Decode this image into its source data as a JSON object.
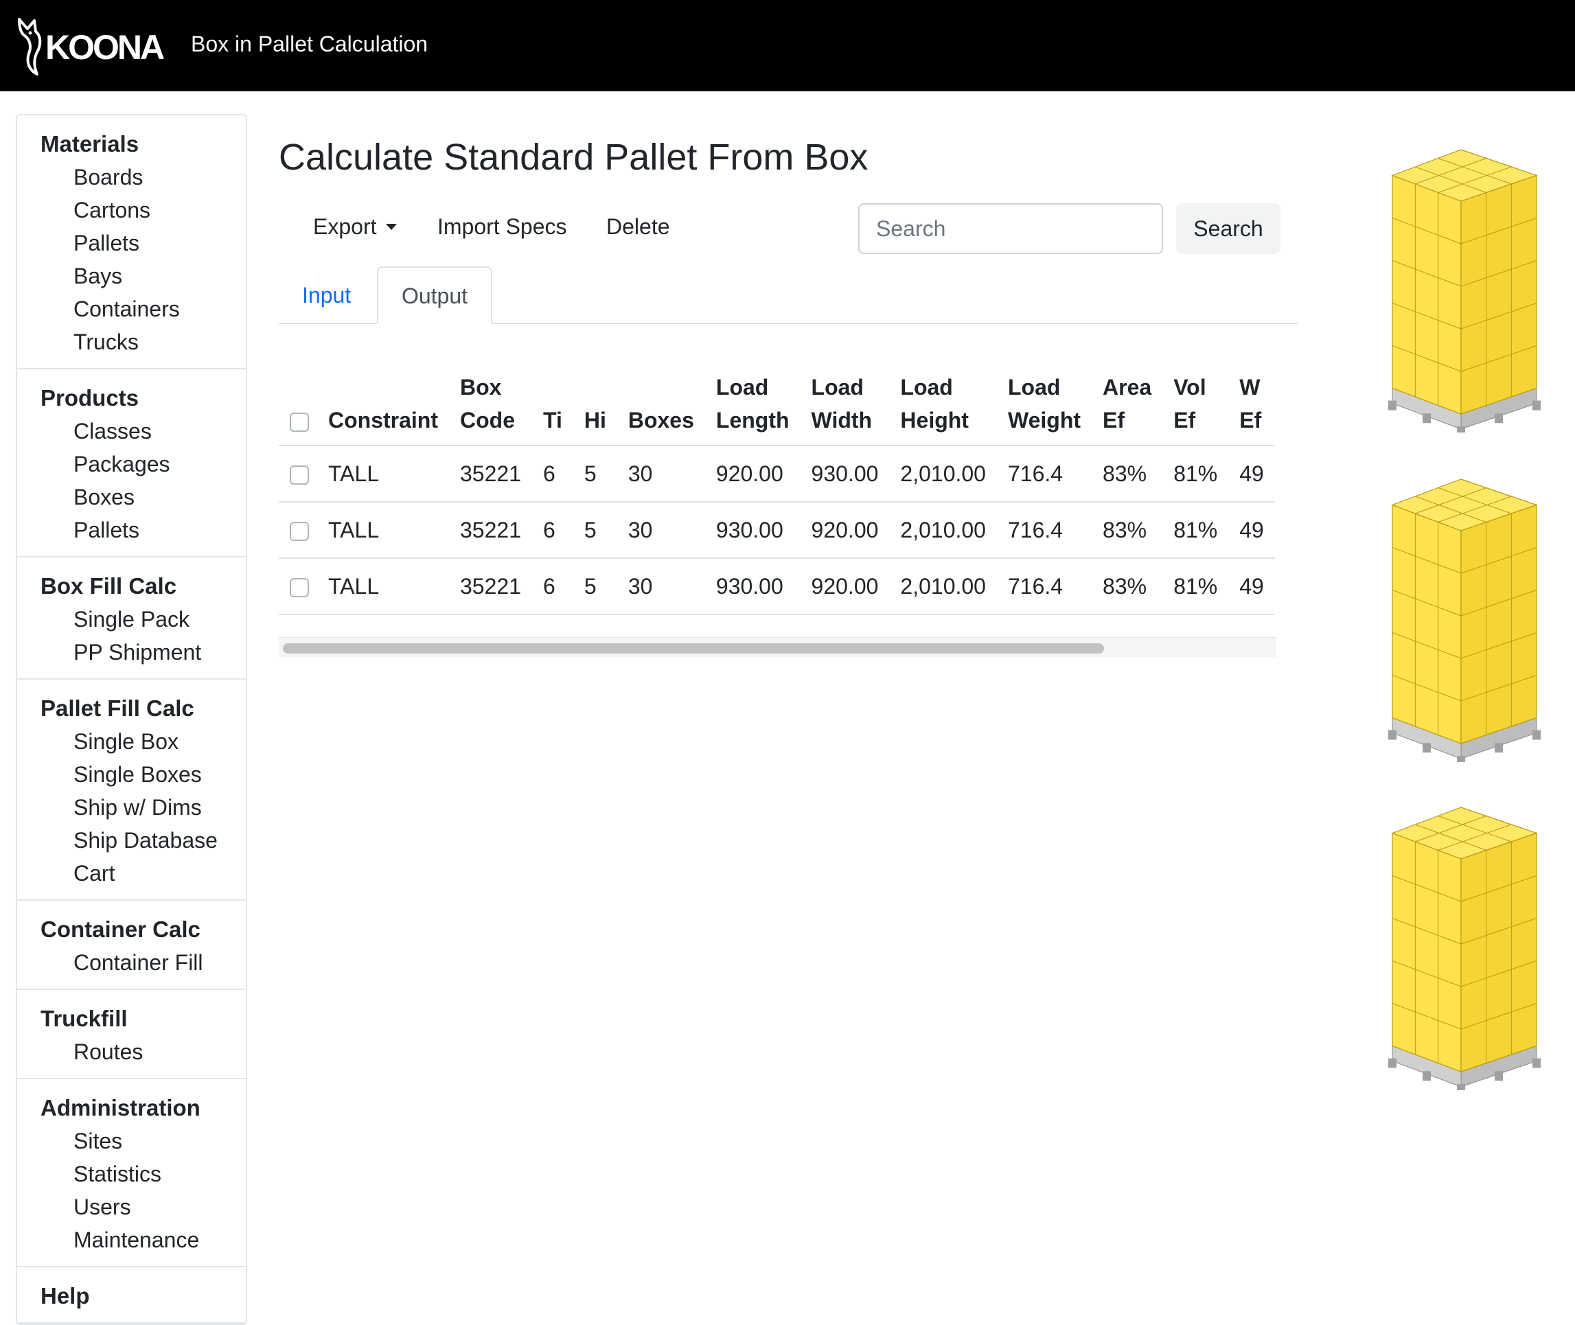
{
  "header": {
    "logo_text": "KOONA",
    "title": "Box in Pallet Calculation"
  },
  "sidebar": {
    "sections": [
      {
        "title": "Materials",
        "items": [
          "Boards",
          "Cartons",
          "Pallets",
          "Bays",
          "Containers",
          "Trucks"
        ]
      },
      {
        "title": "Products",
        "items": [
          "Classes",
          "Packages",
          "Boxes",
          "Pallets"
        ]
      },
      {
        "title": "Box Fill Calc",
        "items": [
          "Single Pack",
          "PP Shipment"
        ]
      },
      {
        "title": "Pallet Fill Calc",
        "items": [
          "Single Box",
          "Single Boxes",
          "Ship w/ Dims",
          "Ship Database",
          "Cart"
        ]
      },
      {
        "title": "Container Calc",
        "items": [
          "Container Fill"
        ]
      },
      {
        "title": "Truckfill",
        "items": [
          "Routes"
        ]
      },
      {
        "title": "Administration",
        "items": [
          "Sites",
          "Statistics",
          "Users",
          "Maintenance"
        ]
      },
      {
        "title": "Help",
        "items": []
      }
    ]
  },
  "main": {
    "title": "Calculate Standard Pallet From Box",
    "toolbar": {
      "export": "Export",
      "import_specs": "Import Specs",
      "delete": "Delete"
    },
    "search": {
      "placeholder": "Search",
      "button": "Search"
    },
    "tabs": [
      {
        "label": "Input",
        "active": false
      },
      {
        "label": "Output",
        "active": true
      }
    ],
    "table": {
      "headers": [
        [
          "",
          "Constraint"
        ],
        [
          "Box",
          "Code"
        ],
        [
          "",
          "Ti"
        ],
        [
          "",
          "Hi"
        ],
        [
          "",
          "Boxes"
        ],
        [
          "Load",
          "Length"
        ],
        [
          "Load",
          "Width"
        ],
        [
          "Load",
          "Height"
        ],
        [
          "Load",
          "Weight"
        ],
        [
          "Area",
          "Ef"
        ],
        [
          "Vol",
          "Ef"
        ],
        [
          "W",
          "Ef"
        ]
      ],
      "rows": [
        [
          "TALL",
          "35221",
          "6",
          "5",
          "30",
          "920.00",
          "930.00",
          "2,010.00",
          "716.4",
          "83%",
          "81%",
          "49"
        ],
        [
          "TALL",
          "35221",
          "6",
          "5",
          "30",
          "930.00",
          "920.00",
          "2,010.00",
          "716.4",
          "83%",
          "81%",
          "49"
        ],
        [
          "TALL",
          "35221",
          "6",
          "5",
          "30",
          "930.00",
          "920.00",
          "2,010.00",
          "716.4",
          "83%",
          "81%",
          "49"
        ]
      ],
      "scroll_fraction": 0.83
    }
  },
  "colors": {
    "box_yellow": "#FFE24D",
    "box_line": "#b99a10",
    "link_blue": "#0d6efd"
  }
}
